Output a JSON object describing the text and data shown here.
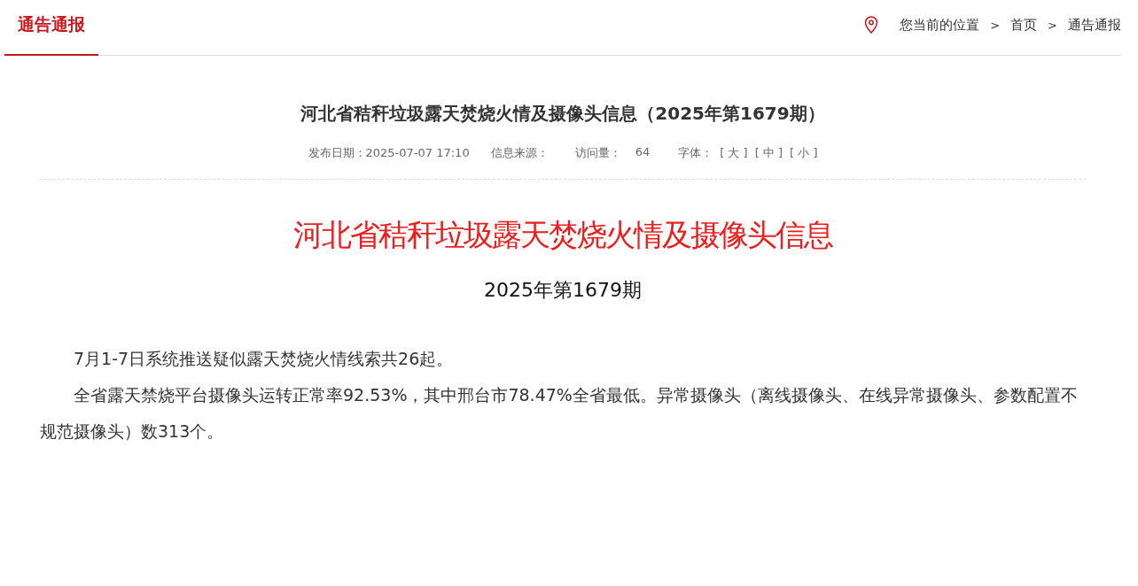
{
  "section_title": "通告通报",
  "breadcrumb": {
    "label": "您当前的位置",
    "items": [
      "首页",
      "通告通报"
    ],
    "separator": ">"
  },
  "article": {
    "title": "河北省秸秆垃圾露天焚烧火情及摄像头信息（2025年第1679期）",
    "meta": {
      "date": "发布日期：2025-07-07 17:10",
      "source": "信息来源：",
      "views_label": "访问量：",
      "views": "64",
      "font_label": "字体：",
      "font_sizes": [
        "[ 大 ]",
        "[ 中 ]",
        "[ 小 ]"
      ]
    },
    "headline": "河北省秸秆垃圾露天焚烧火情及摄像头信息",
    "issue": "2025年第1679期",
    "paragraphs": [
      "7月1-7日系统推送疑似露天焚烧火情线索共26起。",
      "全省露天禁烧平台摄像头运转正常率92.53%，其中邢台市78.47%全省最低。异常摄像头（离线摄像头、在线异常摄像头、参数配置不规范摄像头）数313个。"
    ]
  }
}
